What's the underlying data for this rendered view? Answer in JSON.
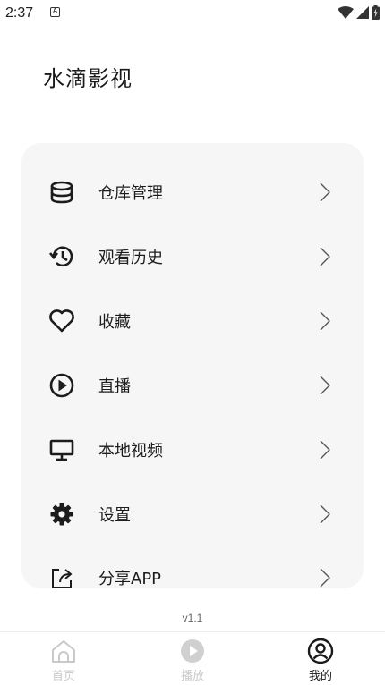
{
  "status_bar": {
    "time": "2:37",
    "notification_glyph": "A"
  },
  "page": {
    "title": "水滴影视"
  },
  "menu": {
    "items": [
      {
        "label": "仓库管理",
        "icon": "database-icon"
      },
      {
        "label": "观看历史",
        "icon": "history-icon"
      },
      {
        "label": "收藏",
        "icon": "heart-icon"
      },
      {
        "label": "直播",
        "icon": "play-circle-icon"
      },
      {
        "label": "本地视频",
        "icon": "monitor-icon"
      },
      {
        "label": "设置",
        "icon": "gear-icon"
      },
      {
        "label": "分享APP",
        "icon": "share-icon"
      }
    ]
  },
  "version": "v1.1",
  "bottom_nav": {
    "items": [
      {
        "label": "首页",
        "icon": "home-icon",
        "active": false
      },
      {
        "label": "播放",
        "icon": "play-icon",
        "active": false
      },
      {
        "label": "我的",
        "icon": "profile-icon",
        "active": true
      }
    ]
  },
  "colors": {
    "card_background": "#f6f6f6",
    "text_primary": "#1c1c1c",
    "nav_inactive": "#c9c9c9",
    "nav_active": "#1a1a1a"
  }
}
